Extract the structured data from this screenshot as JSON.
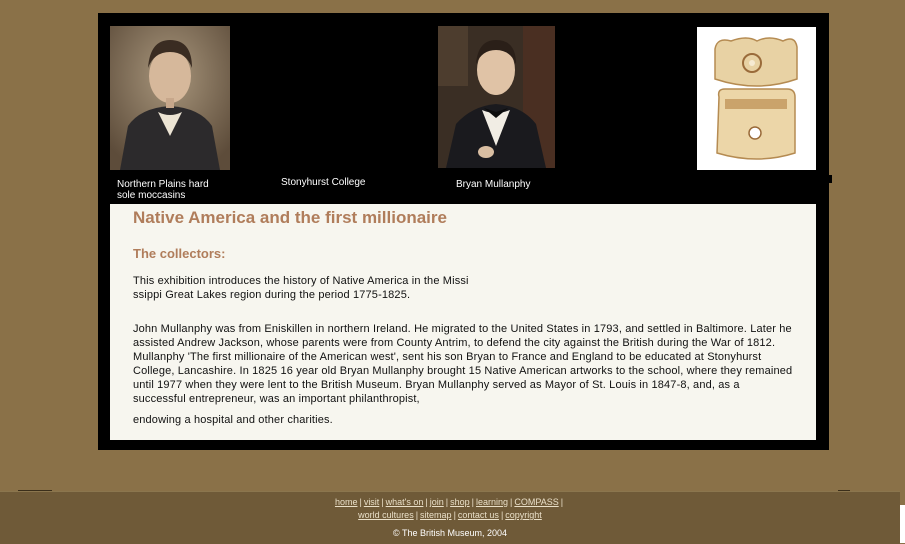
{
  "gallery": {
    "items": [
      {
        "caption": "Northern Plains hard sole moccasins"
      },
      {
        "caption": "Stonyhurst College"
      },
      {
        "caption": "Bryan Mullanphy"
      }
    ]
  },
  "content": {
    "title": "Native America and the first millionaire",
    "subtitle": "The collectors:",
    "intro_line1": "This exhibition introduces the history of Native America in the Missi",
    "intro_line2": "ssippi Great Lakes region during the period 1775-1825.",
    "body": "John Mullanphy was from Eniskillen in northern Ireland. He migrated to the United States in 1793, and settled in Baltimore. Later he assisted Andrew Jackson, whose parents were from County Antrim, to defend the city against the British during the War of 1812. Mullanphy 'The first millionaire of the American west', sent his son Bryan to France and England to be educated at Stonyhurst College, Lancashire. In 1825 16 year old Bryan Mullanphy brought 15 Native American artworks to the school, where they remained until 1977 when they were lent to the British Museum. Bryan Mullanphy served as Mayor of St. Louis in 1847-8, and, as a successful entrepreneur, was an important philanthropist,",
    "body_end": "endowing a hospital and other charities."
  },
  "footer": {
    "nav_row1": [
      "home",
      "visit",
      "what's on",
      "join",
      "shop",
      "learning",
      "COMPASS"
    ],
    "nav_row2": [
      "world cultures",
      "sitemap",
      "contact us",
      "copyright"
    ],
    "copyright": "The British Museum, 2004"
  }
}
